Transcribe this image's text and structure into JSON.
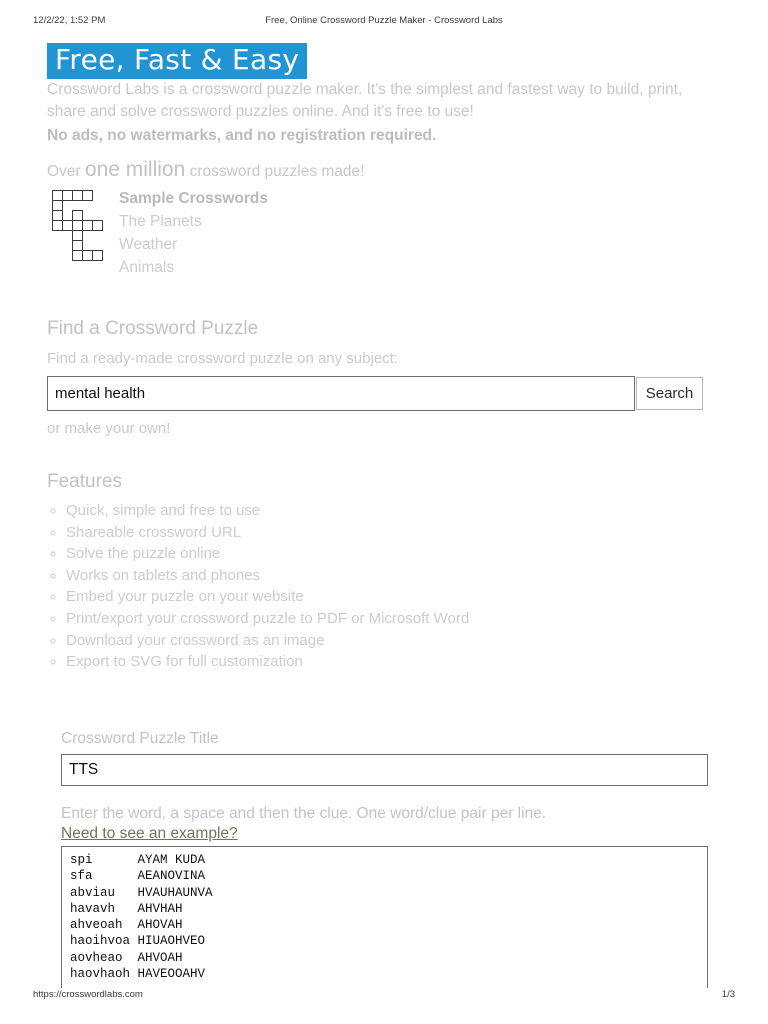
{
  "print_header": {
    "date": "12/2/22, 1:52 PM",
    "title": "Free, Online Crossword Puzzle Maker - Crossword Labs"
  },
  "print_footer": {
    "url": "https://crosswordlabs.com",
    "page": "1/3"
  },
  "colors": {
    "banner_blue": "#2195d4",
    "banner_text": "#ffffff",
    "body_text": "#c8c8c8",
    "link": "#7a7059",
    "input_border": "#6d6d6d"
  },
  "hero": {
    "banner_text": "Free, Fast & Easy",
    "intro": "Crossword Labs is a crossword puzzle maker. It's the simplest and fastest way to build, print, share and solve crossword puzzles online. And it's free to use!",
    "no_ads": "No ads, no watermarks, and no registration required.",
    "over_prefix": "Over ",
    "over_count": "one million",
    "over_suffix": " crossword puzzles made!"
  },
  "samples": {
    "title": "Sample Crosswords",
    "links": [
      {
        "label": "The Planets"
      },
      {
        "label": "Weather"
      },
      {
        "label": "Animals"
      }
    ],
    "grid_cells": [
      [
        0,
        0
      ],
      [
        1,
        0
      ],
      [
        2,
        0
      ],
      [
        3,
        0
      ],
      [
        0,
        1
      ],
      [
        0,
        2
      ],
      [
        2,
        2
      ],
      [
        0,
        3
      ],
      [
        1,
        3
      ],
      [
        2,
        3
      ],
      [
        3,
        3
      ],
      [
        4,
        3
      ],
      [
        2,
        4
      ],
      [
        2,
        5
      ],
      [
        2,
        6
      ],
      [
        3,
        6
      ],
      [
        4,
        6
      ]
    ]
  },
  "find": {
    "heading": "Find a Crossword Puzzle",
    "subtitle": "Find a ready-made crossword puzzle on any subject:",
    "search_value": "mental health",
    "search_placeholder": "",
    "search_button": "Search",
    "make_own": "or make your own!"
  },
  "features": {
    "heading": "Features",
    "items": [
      "Quick, simple and free to use",
      "Shareable crossword URL",
      "Solve the puzzle online",
      "Works on tablets and phones",
      "Embed your puzzle on your website",
      "Print/export your crossword puzzle to PDF or Microsoft Word",
      "Download your crossword as an image",
      "Export to SVG for full customization"
    ]
  },
  "puzzle_form": {
    "title_label": "Crossword Puzzle Title",
    "title_value": "TTS",
    "title_placeholder": "",
    "hint": "Enter the word, a space and then the clue. One word/clue pair per line.",
    "example_link": "Need to see an example?",
    "words_value": "spi      AYAM KUDA\nsfa      AEANOVINA\nabviau   HVAUHAUNVA\nhavavh   AHVHAH\nahveoah  AHOVAH\nhaoihvoa HIUAOHVEO\naovheao  AHVOAH\nhaovhaoh HAVEOOAHV",
    "words_placeholder": ""
  }
}
